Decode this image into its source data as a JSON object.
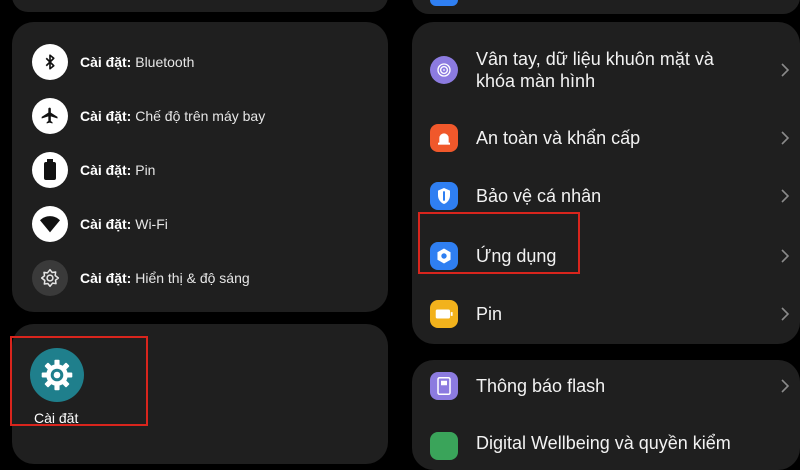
{
  "quick_settings": {
    "prefix": "Cài đặt:",
    "items": [
      {
        "label": "Bluetooth",
        "icon": "bluetooth-icon"
      },
      {
        "label": "Chế độ trên máy bay",
        "icon": "airplane-icon"
      },
      {
        "label": "Pin",
        "icon": "battery-icon"
      },
      {
        "label": "Wi-Fi",
        "icon": "wifi-icon"
      },
      {
        "label": "Hiển thị & độ sáng",
        "icon": "brightness-icon"
      }
    ]
  },
  "app_shortcut": {
    "label": "Cài đặt",
    "icon": "settings-gear-icon",
    "color": "#1f7f8c"
  },
  "settings_list": {
    "group1": [
      {
        "label_line1": "Vân tay, dữ liệu khuôn mặt và",
        "label_line2": "khóa màn hình",
        "icon": "fingerprint-icon",
        "color": "#8c7be0"
      },
      {
        "label": "An toàn và khẩn cấp",
        "icon": "emergency-icon",
        "color": "#f0582b"
      },
      {
        "label": "Bảo vệ cá nhân",
        "icon": "privacy-shield-icon",
        "color": "#2f7ff2"
      },
      {
        "label": "Ứng dụng",
        "icon": "apps-icon",
        "color": "#2f7ff2"
      },
      {
        "label": "Pin",
        "icon": "battery-icon",
        "color": "#f2b21c"
      }
    ],
    "group2": [
      {
        "label": "Thông báo flash",
        "icon": "flash-notification-icon",
        "color": "#8c7be0"
      },
      {
        "label": "Digital Wellbeing và quyền kiểm",
        "icon": "wellbeing-icon",
        "color": "#3aa45a"
      }
    ]
  },
  "colors": {
    "highlight": "#d9251d",
    "card": "#1f1f1f",
    "background": "#000000"
  }
}
